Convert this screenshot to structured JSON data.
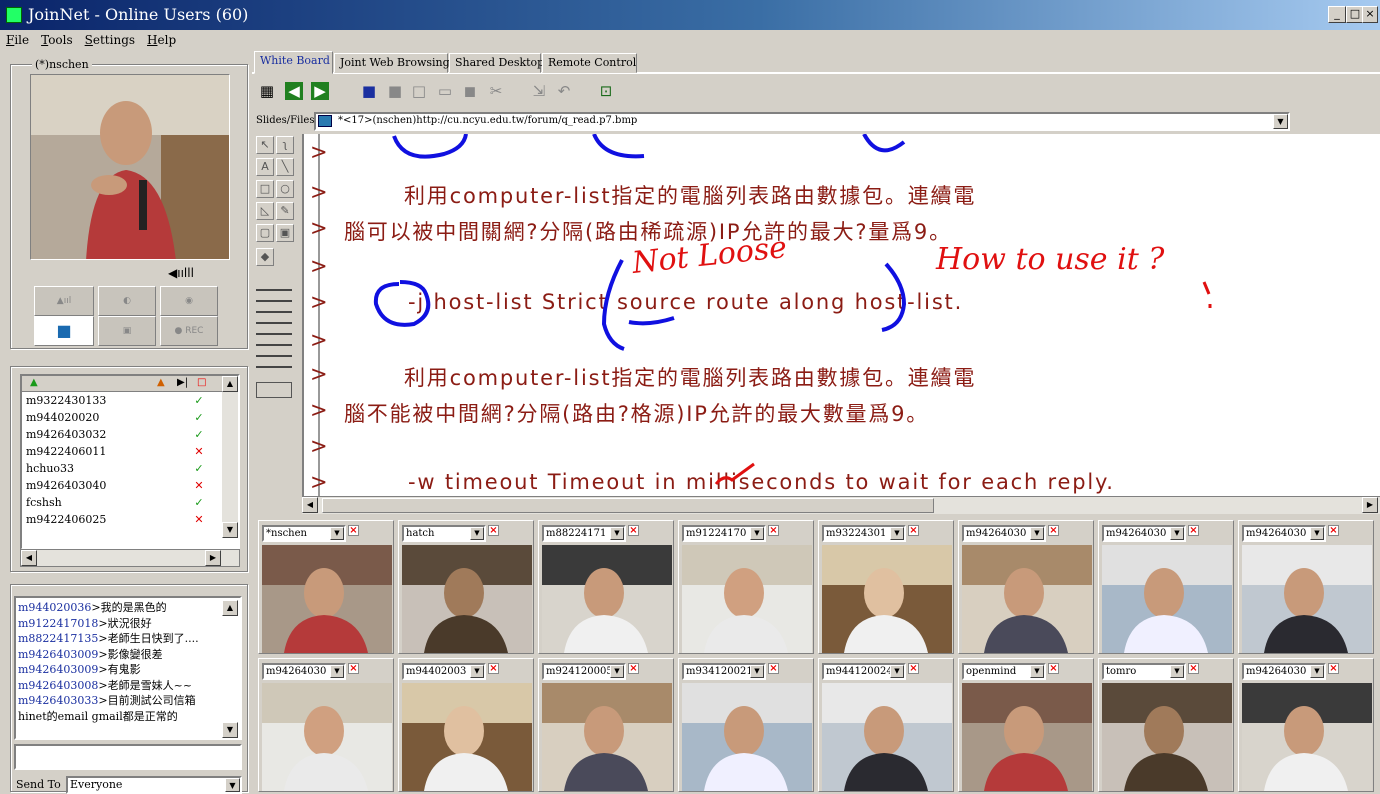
{
  "window": {
    "title": "JoinNet - Online Users (60)"
  },
  "menu": [
    "File",
    "Tools",
    "Settings",
    "Help"
  ],
  "presenter": {
    "label": "(*)nschen"
  },
  "volume_icon": "speaker-icon",
  "controls": {
    "rec_label": "● REC"
  },
  "user_list": [
    {
      "name": "m9322430133",
      "status": "ok"
    },
    {
      "name": "m944020020",
      "status": "ok"
    },
    {
      "name": "m9426403032",
      "status": "ok"
    },
    {
      "name": "m9422406011",
      "status": "bad"
    },
    {
      "name": "hchuo33",
      "status": "ok"
    },
    {
      "name": "m9426403040",
      "status": "bad"
    },
    {
      "name": "fcshsh",
      "status": "ok"
    },
    {
      "name": "m9422406025",
      "status": "bad"
    }
  ],
  "chat": [
    {
      "nick": "m944020036",
      "msg": ">我的是黑色的"
    },
    {
      "nick": "m9122417018",
      "msg": ">狀況很好"
    },
    {
      "nick": "m8822417135",
      "msg": ">老師生日快到了...."
    },
    {
      "nick": "m9426403009",
      "msg": ">影像變很差"
    },
    {
      "nick": "m9426403009",
      "msg": ">有鬼影"
    },
    {
      "nick": "m9426403008",
      "msg": ">老師是雪妹人~~"
    },
    {
      "nick": "m9426403033",
      "msg": ">目前測試公司信箱"
    },
    {
      "nick": "",
      "msg": "hinet的email gmail都是正常的"
    }
  ],
  "send_to": {
    "label": "Send To",
    "value": "Everyone"
  },
  "tabs": [
    "White Board",
    "Joint Web Browsing",
    "Shared Desktop",
    "Remote Control"
  ],
  "slides": {
    "label": "Slides/Files",
    "value": "*<17>(nschen)http://cu.ncyu.edu.tw/forum/q_read.p7.bmp"
  },
  "whiteboard": {
    "lines": [
      {
        "gt": ">",
        "text": ""
      },
      {
        "gt": ">",
        "text": "利用computer-list指定的電腦列表路由數據包。連續電"
      },
      {
        "gt": ">",
        "text": "腦可以被中間關網?分隔(路由稀疏源)IP允許的最大?量爲9。"
      },
      {
        "gt": ">",
        "text": ""
      },
      {
        "gt": ">",
        "text": "-j host-list Strict source route along host-list."
      },
      {
        "gt": ">",
        "text": ""
      },
      {
        "gt": ">",
        "text": "利用computer-list指定的電腦列表路由數據包。連續電"
      },
      {
        "gt": ">",
        "text": "腦不能被中間網?分隔(路由?格源)IP允許的最大數量爲9。"
      },
      {
        "gt": ">",
        "text": ""
      },
      {
        "gt": ">",
        "text": "-w timeout Timeout in milliseconds to wait for each reply."
      }
    ],
    "annotations": {
      "note1": "Not Loose",
      "note2": "How to use it ?"
    },
    "ink_colors": {
      "blue": "#1010e0",
      "red": "#e01010"
    }
  },
  "video_tiles_row1": [
    "*nschen",
    "hatch",
    "m88224171",
    "m91224170",
    "m93224301",
    "m94264030",
    "m94264030",
    "m94264030"
  ],
  "video_tiles_row2": [
    "m94264030",
    "m94402003",
    "m924120005",
    "m934120021",
    "m944120024",
    "openmind",
    "tomro",
    "m94264030"
  ]
}
